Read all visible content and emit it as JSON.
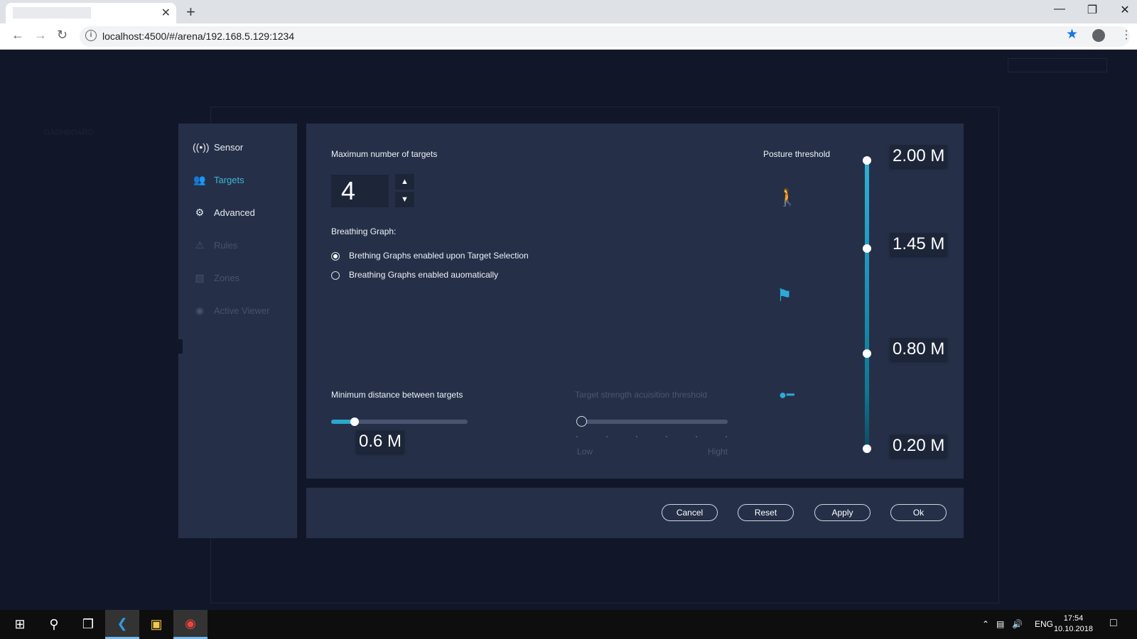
{
  "browser": {
    "url": "localhost:4500/#/arena/192.168.5.129:1234",
    "tab_close": "✕",
    "new_tab": "+"
  },
  "ghost_ui": {
    "dashboard": "DASHBOARD"
  },
  "sidebar": {
    "items": [
      {
        "label": "Sensor",
        "icon": "sensor-icon",
        "state": "normal"
      },
      {
        "label": "Targets",
        "icon": "targets-icon",
        "state": "active"
      },
      {
        "label": "Advanced",
        "icon": "gear-icon",
        "state": "normal"
      },
      {
        "label": "Rules",
        "icon": "warning-icon",
        "state": "disabled"
      },
      {
        "label": "Zones",
        "icon": "zones-icon",
        "state": "disabled"
      },
      {
        "label": "Active Viewer",
        "icon": "viewer-icon",
        "state": "disabled"
      }
    ]
  },
  "targets": {
    "max_label": "Maximum number of targets",
    "max_value": "4",
    "breathing_label": "Breathing Graph:",
    "breathing_options": [
      {
        "label": "Brething Graphs enabled upon Target Selection",
        "selected": true
      },
      {
        "label": "Breathing Graphs enabled auomatically",
        "selected": false
      }
    ],
    "min_distance_label": "Minimum distance between targets",
    "min_distance_value": "0.6 M",
    "min_distance_fraction": 0.17,
    "strength_label": "Target strength acuisition threshold",
    "strength_low": "Low",
    "strength_high": "Hight",
    "strength_fraction": 0.0,
    "posture_label": "Posture threshold",
    "posture_values": [
      "2.00 M",
      "1.45 M",
      "0.80 M",
      "0.20 M"
    ]
  },
  "footer": {
    "cancel": "Cancel",
    "reset": "Reset",
    "apply": "Apply",
    "ok": "Ok"
  },
  "taskbar": {
    "lang": "ENG",
    "time": "17:54",
    "date": "10.10.2018"
  },
  "colors": {
    "accent": "#2aa7cf",
    "panel": "#253048",
    "background": "#111729"
  }
}
